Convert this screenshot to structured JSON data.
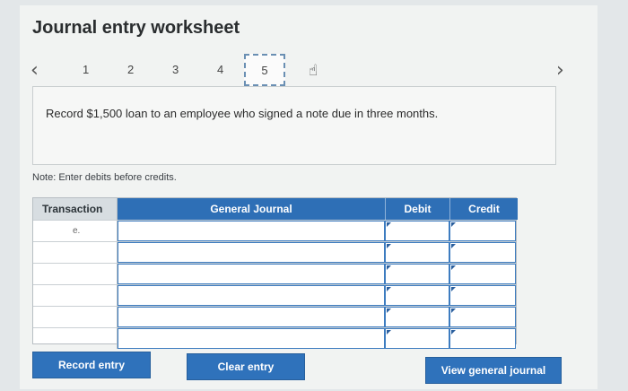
{
  "title": "Journal entry worksheet",
  "nav": {
    "prev_icon": "chevron-left-icon",
    "next_icon": "chevron-right-icon",
    "steps": [
      "1",
      "2",
      "3",
      "4",
      "5"
    ],
    "active_step": "5",
    "cursor_icon": "hand-pointer-icon"
  },
  "task": {
    "text": "Record $1,500 loan to an employee who signed a note due in three months."
  },
  "note": "Note: Enter debits before credits.",
  "journal": {
    "headers": {
      "transaction": "Transaction",
      "general_journal": "General Journal",
      "debit": "Debit",
      "credit": "Credit"
    },
    "rows": [
      {
        "transaction": "e."
      },
      {
        "transaction": ""
      },
      {
        "transaction": ""
      },
      {
        "transaction": ""
      },
      {
        "transaction": ""
      },
      {
        "transaction": ""
      }
    ]
  },
  "buttons": {
    "record_entry": "Record entry",
    "clear_entry": "Clear entry",
    "view_general_journal": "View general journal"
  },
  "colors": {
    "header_blue": "#2e6fb6",
    "button_blue": "#2f72bb"
  }
}
